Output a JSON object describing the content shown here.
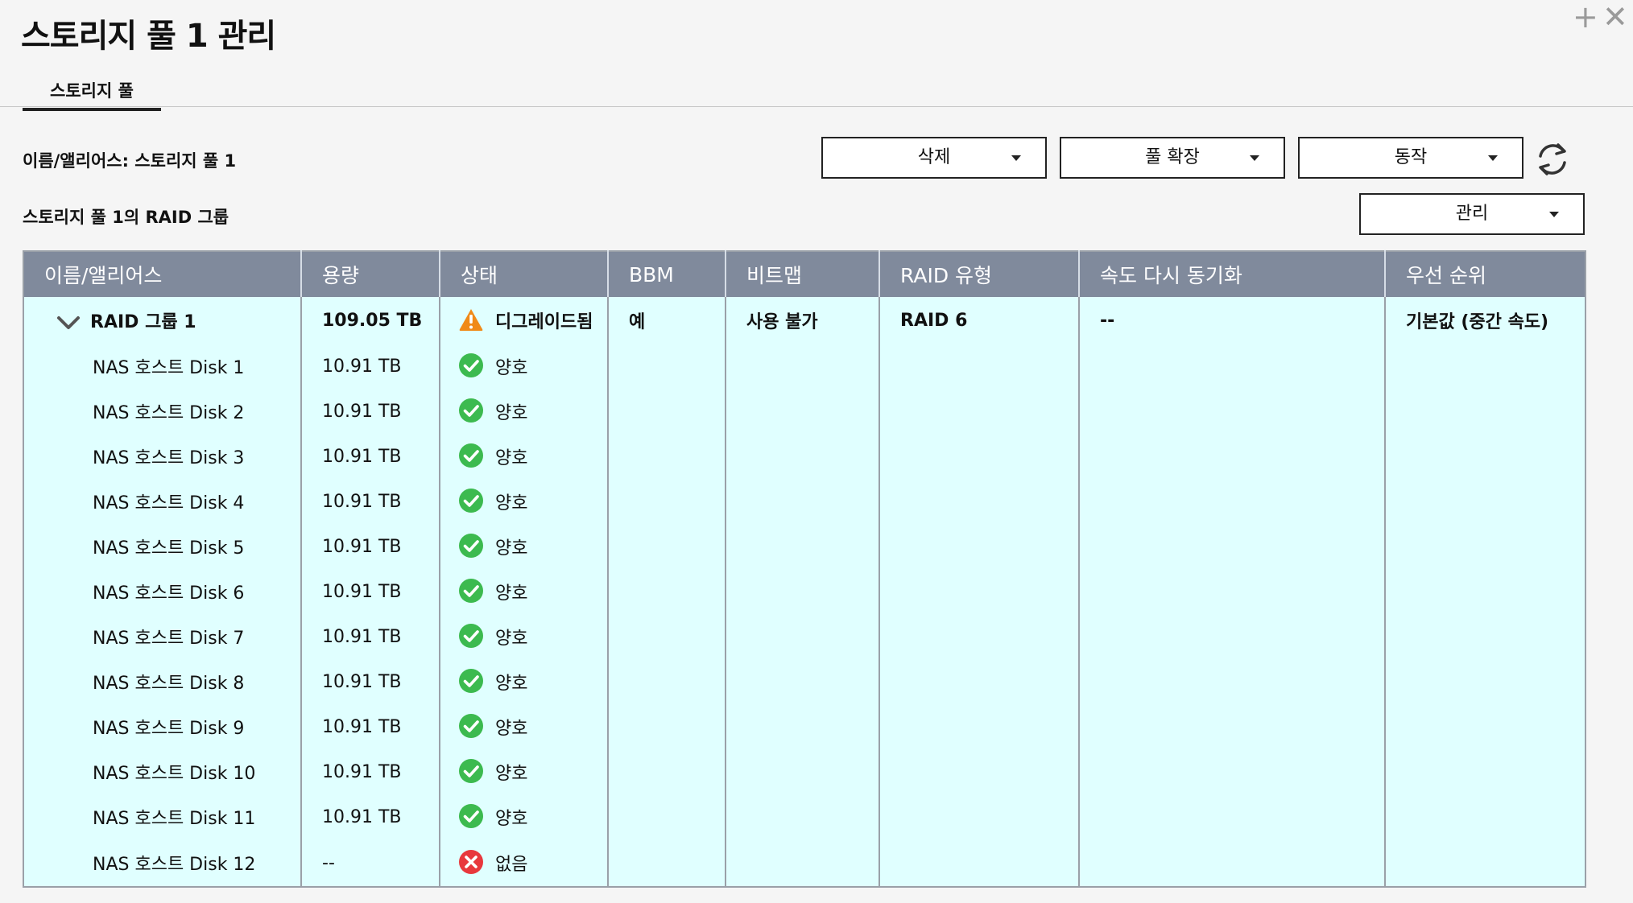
{
  "window": {
    "title": "스토리지 풀 1 관리",
    "controls": [
      "plus-icon",
      "close-icon"
    ]
  },
  "tabs": [
    {
      "label": "스토리지 풀",
      "active": true
    }
  ],
  "info": {
    "name_alias": "이름/앨리어스: 스토리지 풀 1",
    "raid_group_heading": "스토리지 풀 1의 RAID 그룹"
  },
  "toolbar": {
    "delete_label": "삭제",
    "expand_label": "풀 확장",
    "action_label": "동작",
    "manage_label": "관리",
    "refresh_icon": "refresh-icon"
  },
  "colors": {
    "header_bg": "#808a9c",
    "table_bg": "#e0ffff",
    "ok": "#3cba4f",
    "warning": "#f08a18",
    "error": "#e8383d"
  },
  "table": {
    "columns": [
      "이름/앨리어스",
      "용량",
      "상태",
      "BBM",
      "비트맵",
      "RAID 유형",
      "속도 다시 동기화",
      "우선 순위"
    ],
    "group": {
      "name": "RAID 그룹 1",
      "capacity": "109.05 TB",
      "status": "디그레이드됨",
      "status_icon": "warning-icon",
      "bbm": "예",
      "bitmap": "사용 불가",
      "raid_type": "RAID 6",
      "resync_speed": "--",
      "priority": "기본값 (중간 속도)"
    },
    "disks": [
      {
        "name": "NAS 호스트 Disk 1",
        "capacity": "10.91 TB",
        "status": "양호",
        "status_icon": "check-circle-icon"
      },
      {
        "name": "NAS 호스트 Disk 2",
        "capacity": "10.91 TB",
        "status": "양호",
        "status_icon": "check-circle-icon"
      },
      {
        "name": "NAS 호스트 Disk 3",
        "capacity": "10.91 TB",
        "status": "양호",
        "status_icon": "check-circle-icon"
      },
      {
        "name": "NAS 호스트 Disk 4",
        "capacity": "10.91 TB",
        "status": "양호",
        "status_icon": "check-circle-icon"
      },
      {
        "name": "NAS 호스트 Disk 5",
        "capacity": "10.91 TB",
        "status": "양호",
        "status_icon": "check-circle-icon"
      },
      {
        "name": "NAS 호스트 Disk 6",
        "capacity": "10.91 TB",
        "status": "양호",
        "status_icon": "check-circle-icon"
      },
      {
        "name": "NAS 호스트 Disk 7",
        "capacity": "10.91 TB",
        "status": "양호",
        "status_icon": "check-circle-icon"
      },
      {
        "name": "NAS 호스트 Disk 8",
        "capacity": "10.91 TB",
        "status": "양호",
        "status_icon": "check-circle-icon"
      },
      {
        "name": "NAS 호스트 Disk 9",
        "capacity": "10.91 TB",
        "status": "양호",
        "status_icon": "check-circle-icon"
      },
      {
        "name": "NAS 호스트 Disk 10",
        "capacity": "10.91 TB",
        "status": "양호",
        "status_icon": "check-circle-icon"
      },
      {
        "name": "NAS 호스트 Disk 11",
        "capacity": "10.91 TB",
        "status": "양호",
        "status_icon": "check-circle-icon"
      },
      {
        "name": "NAS 호스트 Disk 12",
        "capacity": "--",
        "status": "없음",
        "status_icon": "error-circle-icon"
      }
    ]
  }
}
